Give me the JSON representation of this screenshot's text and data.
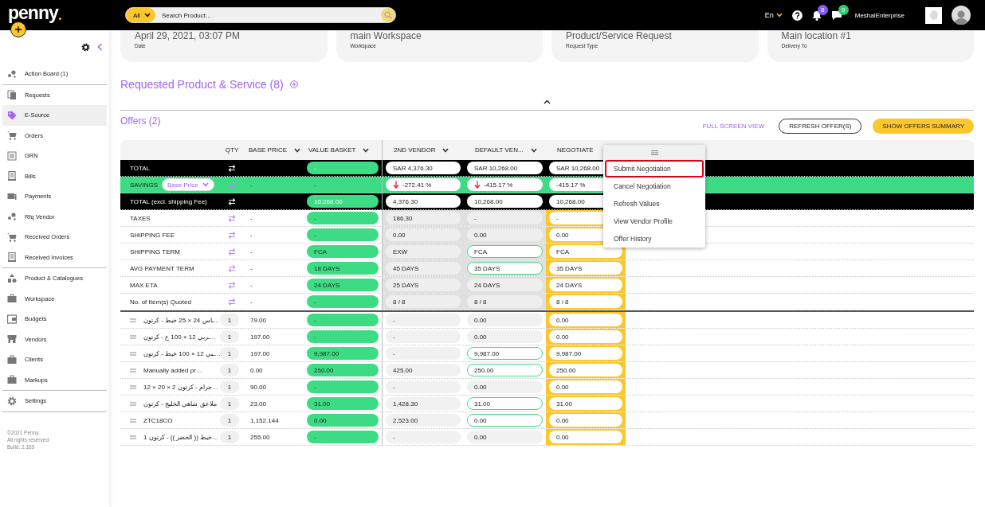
{
  "topbar": {
    "logo": "penny",
    "search_scope": "All",
    "search_placeholder": "Search Product...",
    "language": "En",
    "notifications_count": "8",
    "messages_count": "9",
    "account_name": "MeshalEnterprise"
  },
  "sidebar": {
    "groups": [
      [
        {
          "label": "Action Board (1)",
          "selected": false
        }
      ],
      [
        {
          "label": "Requests",
          "selected": false
        },
        {
          "label": "E-Source",
          "selected": true
        },
        {
          "label": "Orders",
          "selected": false
        },
        {
          "label": "GRN",
          "selected": false
        },
        {
          "label": "Bills",
          "selected": false
        },
        {
          "label": "Payments",
          "selected": false
        },
        {
          "label": "Rfq Vendor",
          "selected": false
        },
        {
          "label": "Received Orders",
          "selected": false
        },
        {
          "label": "Received Invoices",
          "selected": false
        }
      ],
      [
        {
          "label": "Product & Catalogues",
          "selected": false
        },
        {
          "label": "Workspace",
          "selected": false
        },
        {
          "label": "Budgets",
          "selected": false
        },
        {
          "label": "Vendors",
          "selected": false
        },
        {
          "label": "Clients",
          "selected": false
        },
        {
          "label": "Markups",
          "selected": false
        }
      ],
      [
        {
          "label": "Settings",
          "selected": false
        }
      ]
    ],
    "footer": [
      "©2021 Penny.",
      "All rights reserved.",
      "Build: 2.189"
    ]
  },
  "summary": [
    {
      "label": "Date",
      "value": "April 29, 2021, 03:07 PM"
    },
    {
      "label": "Workspace",
      "value": "main Workspace"
    },
    {
      "label": "Request Type",
      "value": "Product/Service Request"
    },
    {
      "label": "Delivery To",
      "value": "Main location #1"
    }
  ],
  "requested_section": {
    "title": "Requested Product & Service (8)"
  },
  "offers": {
    "title": "Offers (2)",
    "actions": [
      {
        "label": "FULL SCREEN VIEW",
        "kind": "link"
      },
      {
        "label": "REFRESH OFFER(S)",
        "kind": "outline"
      },
      {
        "label": "SHOW OFFERS SUMMARY",
        "kind": "primary"
      }
    ]
  },
  "table": {
    "columns": [
      {
        "label": "QTY",
        "dropdown": false
      },
      {
        "label": "BASE PRICE",
        "dropdown": true
      },
      {
        "label": "VALUE BASKET",
        "dropdown": true
      },
      {
        "label": "2ND VENDOR",
        "dropdown": true
      },
      {
        "label": "DEFAULT VEN...",
        "dropdown": true
      },
      {
        "label": "NEGOTIATE",
        "dropdown": false
      }
    ],
    "summary_rows": [
      {
        "kind": "total",
        "label": "TOTAL",
        "value_basket": "-",
        "vendor2": {
          "value": "SAR 4,376.30",
          "best": false
        },
        "default_vendor": {
          "value": "SAR 10,268.00",
          "best": false
        },
        "negotiate": "SAR 10,268.00"
      },
      {
        "kind": "savings",
        "label": "SAVINGS",
        "basis": "Base Price",
        "base_price": "-",
        "value_basket": "-",
        "vendor2": {
          "value": "-272.41 %",
          "best": false,
          "trend_down": true
        },
        "default_vendor": {
          "value": "-415.17 %",
          "best": false,
          "trend_down": true
        },
        "negotiate": "-415.17 %"
      },
      {
        "kind": "total",
        "label": "TOTAL (excl. shipping Fee)",
        "value_basket": "10,268.00",
        "vendor2": {
          "value": "4,376.30",
          "best": false
        },
        "default_vendor": {
          "value": "10,268.00",
          "best": false
        },
        "negotiate": "10,268.00"
      },
      {
        "kind": "metric",
        "label": "TAXES",
        "base_price": "-",
        "value_basket": "-",
        "vendor2": {
          "value": "186.30",
          "best": false
        },
        "default_vendor": {
          "value": "-",
          "best": false
        },
        "negotiate": "-"
      },
      {
        "kind": "metric",
        "label": "SHIPPING FEE",
        "base_price": "-",
        "value_basket": "-",
        "vendor2": {
          "value": "0.00",
          "best": false
        },
        "default_vendor": {
          "value": "0.00",
          "best": false
        },
        "negotiate": "0.00"
      },
      {
        "kind": "metric",
        "label": "SHIPPING TERM",
        "base_price": "-",
        "value_basket": "FCA",
        "vendor2": {
          "value": "EXW",
          "best": false
        },
        "default_vendor": {
          "value": "FCA",
          "best": true
        },
        "negotiate": "FCA"
      },
      {
        "kind": "metric",
        "label": "AVG PAYMENT TERM",
        "base_price": "-",
        "value_basket": "18 DAYS",
        "vendor2": {
          "value": "45 DAYS",
          "best": false
        },
        "default_vendor": {
          "value": "35 DAYS",
          "best": true
        },
        "negotiate": "35 DAYS"
      },
      {
        "kind": "metric",
        "label": "MAX ETA",
        "base_price": "-",
        "value_basket": "24 DAYS",
        "vendor2": {
          "value": "25 DAYS",
          "best": false
        },
        "default_vendor": {
          "value": "24 DAYS",
          "best": false
        },
        "negotiate": "24 DAYS"
      },
      {
        "kind": "metric",
        "label": "No. of Item(s) Quoted",
        "base_price": "-",
        "value_basket": "-",
        "vendor2": {
          "value": "8 / 8",
          "best": false
        },
        "default_vendor": {
          "value": "8 / 8",
          "best": false
        },
        "negotiate": "8 / 8"
      }
    ],
    "item_rows": [
      {
        "name": "ـاس 24 × 25 خيط - كرتون…",
        "qty": "1",
        "base_price": "79.00",
        "value_basket": "-",
        "vendor2": {
          "value": "-",
          "best": false
        },
        "default_vendor": {
          "value": "0.00",
          "best": false
        },
        "negotiate": "0.00"
      },
      {
        "name": "ـربي 12 × 100 ع - كرتون…",
        "qty": "1",
        "base_price": "197.00",
        "value_basket": "-",
        "vendor2": {
          "value": "-",
          "best": false
        },
        "default_vendor": {
          "value": "0.00",
          "best": false
        },
        "negotiate": "0.00"
      },
      {
        "name": "ـبي 12 × 100 خيط - كرتون…",
        "qty": "1",
        "base_price": "197.00",
        "value_basket": "9,987.00",
        "vendor2": {
          "value": "-",
          "best": false
        },
        "default_vendor": {
          "value": "9,987.00",
          "best": true
        },
        "negotiate": "9,987.00"
      },
      {
        "name": "Manually added pr…",
        "qty": "1",
        "base_price": "0.00",
        "value_basket": "250.00",
        "vendor2": {
          "value": "425.00",
          "best": false
        },
        "default_vendor": {
          "value": "250.00",
          "best": true
        },
        "negotiate": "250.00"
      },
      {
        "name": "12 × 20 × 2 جرام - كرتون…",
        "qty": "1",
        "base_price": "90.00",
        "value_basket": "-",
        "vendor2": {
          "value": "-",
          "best": false
        },
        "default_vendor": {
          "value": "0.00",
          "best": false
        },
        "negotiate": "0.00"
      },
      {
        "name": "ملاعق شاهي الخليج - كرتون",
        "qty": "1",
        "base_price": "23.00",
        "value_basket": "31.00",
        "vendor2": {
          "value": "1,428.30",
          "best": false
        },
        "default_vendor": {
          "value": "31.00",
          "best": true
        },
        "negotiate": "31.00"
      },
      {
        "name": "ZTC18CO",
        "qty": "1",
        "base_price": "1,152.144",
        "value_basket": "0.00",
        "vendor2": {
          "value": "2,523.00",
          "best": false
        },
        "default_vendor": {
          "value": "0.00",
          "best": true
        },
        "negotiate": "0.00"
      },
      {
        "name": "1 خيط (( الخضر )) - كرتون…",
        "qty": "1",
        "base_price": "255.00",
        "value_basket": "-",
        "vendor2": {
          "value": "-",
          "best": false
        },
        "default_vendor": {
          "value": "0.00",
          "best": false
        },
        "negotiate": "0.00"
      }
    ]
  },
  "menu": {
    "items": [
      {
        "label": "Submit Negotiation",
        "selected": true
      },
      {
        "label": "Cancel Negotiation",
        "selected": false
      },
      {
        "label": "Refresh Values",
        "selected": false
      },
      {
        "label": "View Vendor Profile",
        "selected": false
      },
      {
        "label": "Offer History",
        "selected": false
      }
    ]
  }
}
